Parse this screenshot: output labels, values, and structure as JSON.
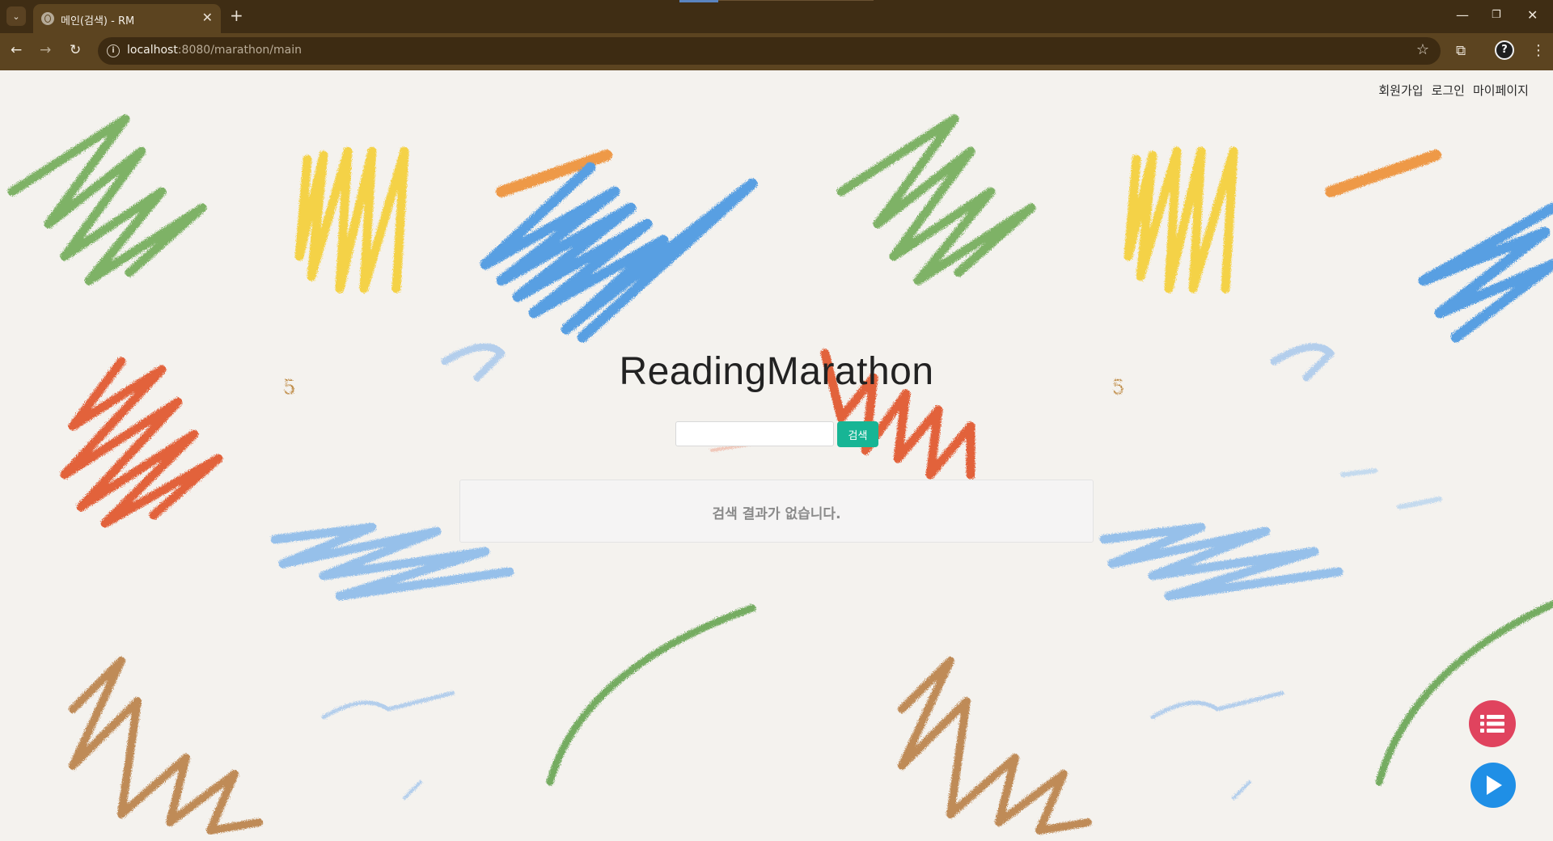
{
  "browser": {
    "tab_title": "메인(검색) - RM",
    "url_host": "localhost",
    "url_path": ":8080/marathon/main"
  },
  "nav": {
    "signup": "회원가입",
    "login": "로그인",
    "mypage": "마이페이지"
  },
  "logo": "ReadingMarathon",
  "search": {
    "button": "검색",
    "placeholder": "",
    "value": ""
  },
  "results": {
    "empty_message": "검색 결과가 없습니다."
  },
  "colors": {
    "search_button": "#17b595",
    "fab_list": "#e0435e",
    "fab_play": "#1f8fe6"
  },
  "icons": {
    "fab_list": "list-icon",
    "fab_play": "play-icon"
  }
}
